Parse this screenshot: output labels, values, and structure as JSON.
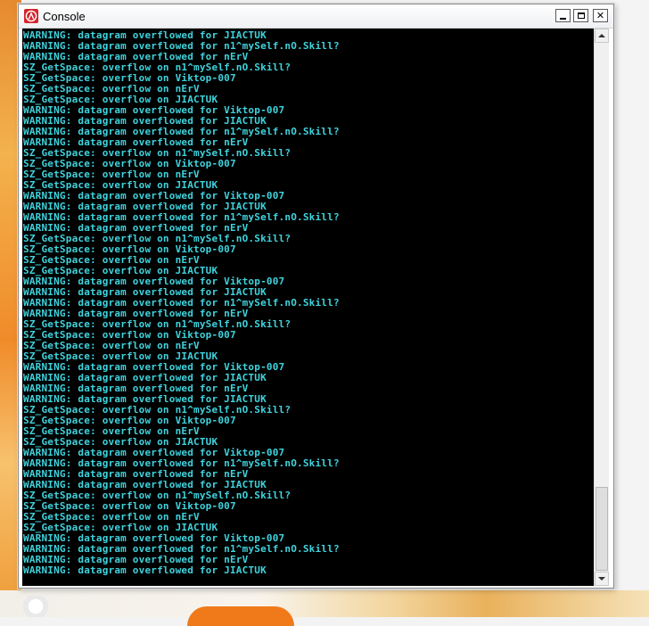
{
  "window": {
    "title": "Console",
    "controls": {
      "minimize": "minimize",
      "maximize": "maximize",
      "close": "✕"
    }
  },
  "console": {
    "text_color": "#3fd3dd",
    "background": "#000000",
    "lines": [
      "WARNING: datagram overflowed for JIACTUK",
      "WARNING: datagram overflowed for n1^mySelf.nO.Skill?",
      "WARNING: datagram overflowed for nErV",
      "SZ_GetSpace: overflow on n1^mySelf.nO.Skill?",
      "SZ_GetSpace: overflow on Viktop-007",
      "SZ_GetSpace: overflow on nErV",
      "SZ_GetSpace: overflow on JIACTUK",
      "WARNING: datagram overflowed for Viktop-007",
      "WARNING: datagram overflowed for JIACTUK",
      "WARNING: datagram overflowed for n1^mySelf.nO.Skill?",
      "WARNING: datagram overflowed for nErV",
      "SZ_GetSpace: overflow on n1^mySelf.nO.Skill?",
      "SZ_GetSpace: overflow on Viktop-007",
      "SZ_GetSpace: overflow on nErV",
      "SZ_GetSpace: overflow on JIACTUK",
      "WARNING: datagram overflowed for Viktop-007",
      "WARNING: datagram overflowed for JIACTUK",
      "WARNING: datagram overflowed for n1^mySelf.nO.Skill?",
      "WARNING: datagram overflowed for nErV",
      "SZ_GetSpace: overflow on n1^mySelf.nO.Skill?",
      "SZ_GetSpace: overflow on Viktop-007",
      "SZ_GetSpace: overflow on nErV",
      "SZ_GetSpace: overflow on JIACTUK",
      "WARNING: datagram overflowed for Viktop-007",
      "WARNING: datagram overflowed for JIACTUK",
      "WARNING: datagram overflowed for n1^mySelf.nO.Skill?",
      "WARNING: datagram overflowed for nErV",
      "SZ_GetSpace: overflow on n1^mySelf.nO.Skill?",
      "SZ_GetSpace: overflow on Viktop-007",
      "SZ_GetSpace: overflow on nErV",
      "SZ_GetSpace: overflow on JIACTUK",
      "WARNING: datagram overflowed for Viktop-007",
      "WARNING: datagram overflowed for JIACTUK",
      "WARNING: datagram overflowed for nErV",
      "WARNING: datagram overflowed for JIACTUK",
      "SZ_GetSpace: overflow on n1^mySelf.nO.Skill?",
      "SZ_GetSpace: overflow on Viktop-007",
      "SZ_GetSpace: overflow on nErV",
      "SZ_GetSpace: overflow on JIACTUK",
      "WARNING: datagram overflowed for Viktop-007",
      "WARNING: datagram overflowed for n1^mySelf.nO.Skill?",
      "WARNING: datagram overflowed for nErV",
      "WARNING: datagram overflowed for JIACTUK",
      "SZ_GetSpace: overflow on n1^mySelf.nO.Skill?",
      "SZ_GetSpace: overflow on Viktop-007",
      "SZ_GetSpace: overflow on nErV",
      "SZ_GetSpace: overflow on JIACTUK",
      "WARNING: datagram overflowed for Viktop-007",
      "WARNING: datagram overflowed for n1^mySelf.nO.Skill?",
      "WARNING: datagram overflowed for nErV",
      "WARNING: datagram overflowed for JIACTUK"
    ]
  },
  "scrollbar": {
    "position": "bottom"
  }
}
